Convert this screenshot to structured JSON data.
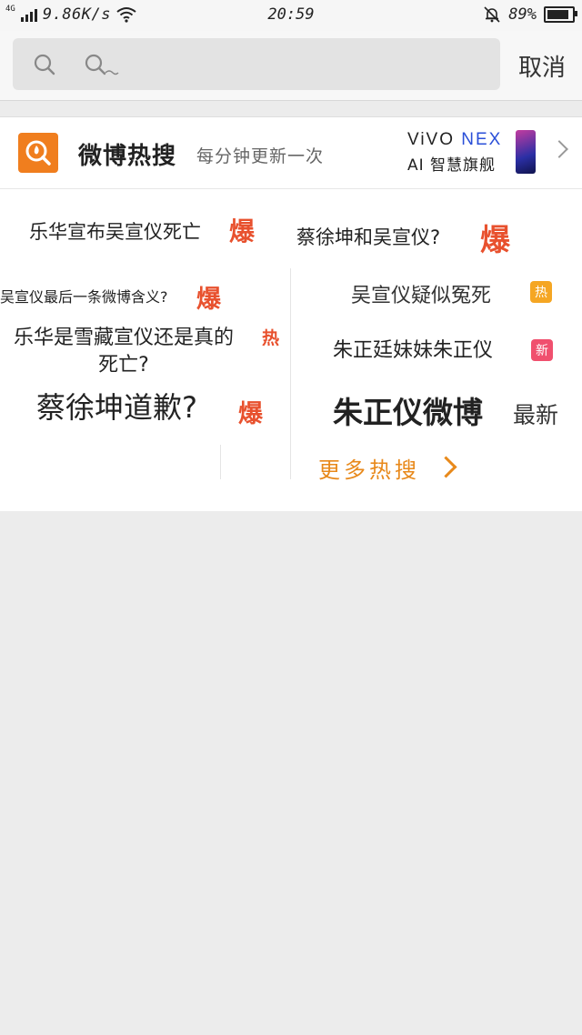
{
  "status_bar": {
    "network": "4G",
    "speed": "9.86K/s",
    "time": "20:59",
    "battery": "89%",
    "battery_level": 0.89
  },
  "search": {
    "input_value": "",
    "cancel_label": "取消"
  },
  "card": {
    "title": "微博热搜",
    "subtitle": "每分钟更新一次",
    "ad": {
      "brand_prefix": "ViVO ",
      "brand_suffix": "NEX",
      "slogan": "AI 智慧旗舰"
    },
    "trends": [
      {
        "text": "乐华宣布吴宣仪死亡",
        "badge": "爆"
      },
      {
        "text": "蔡徐坤和吴宣仪?",
        "badge": "爆"
      },
      {
        "text": "吴宣仪最后一条微博含义?",
        "badge": "爆"
      },
      {
        "text": "吴宣仪疑似冤死",
        "badge": "热"
      },
      {
        "text_line1": "乐华是雪藏宣仪还是真的",
        "text_line2": "死亡?",
        "badge": "热"
      },
      {
        "text": "朱正廷妹妹朱正仪",
        "badge": "新"
      },
      {
        "text": "蔡徐坤道歉?",
        "badge": "爆"
      },
      {
        "text": "朱正仪微博",
        "badge": "最新"
      }
    ],
    "more_label": "更多热搜"
  },
  "colors": {
    "accent_orange": "#f07e1e",
    "hot_red": "#e8512e",
    "hot_badge": "#f5a623",
    "new_badge": "#f0506e",
    "more_link": "#e8891b"
  }
}
